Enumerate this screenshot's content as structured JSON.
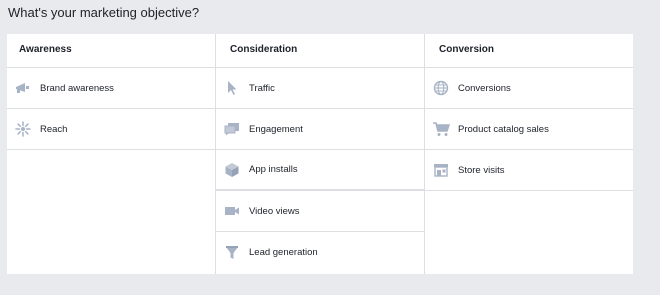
{
  "heading": "What's your marketing objective?",
  "colors": {
    "background": "#e9eaed",
    "card": "#ffffff",
    "border": "#dddfe2",
    "icon": "#a8b3c6",
    "text": "#1d2129"
  },
  "columns": [
    {
      "title": "Awareness",
      "items": [
        {
          "label": "Brand awareness",
          "icon": "megaphone-icon"
        },
        {
          "label": "Reach",
          "icon": "burst-icon"
        }
      ]
    },
    {
      "title": "Consideration",
      "items": [
        {
          "label": "Traffic",
          "icon": "cursor-icon"
        },
        {
          "label": "Engagement",
          "icon": "chat-bubbles-icon"
        },
        {
          "label": "App installs",
          "icon": "cube-icon"
        },
        {
          "label": "Video views",
          "icon": "video-camera-icon"
        },
        {
          "label": "Lead generation",
          "icon": "funnel-icon"
        }
      ]
    },
    {
      "title": "Conversion",
      "items": [
        {
          "label": "Conversions",
          "icon": "globe-icon"
        },
        {
          "label": "Product catalog sales",
          "icon": "cart-icon"
        },
        {
          "label": "Store visits",
          "icon": "storefront-icon"
        }
      ]
    }
  ]
}
